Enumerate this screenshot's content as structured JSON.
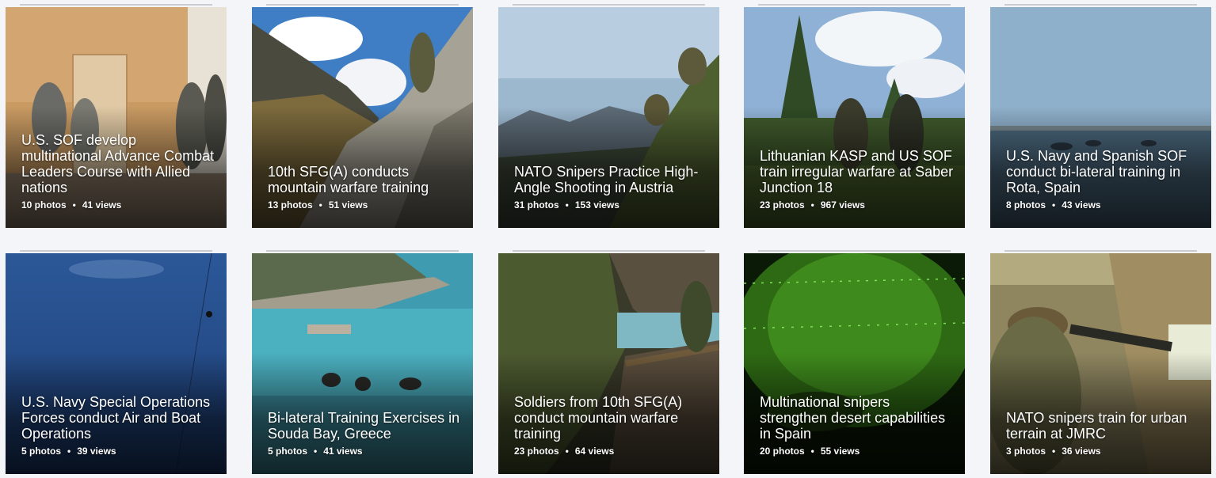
{
  "albums": [
    {
      "title": "U.S. SOF develop multinational Advance Combat Leaders Course with Allied nations",
      "photos": "10 photos",
      "views": "41 views"
    },
    {
      "title": "10th SFG(A) conducts mountain warfare training",
      "photos": "13 photos",
      "views": "51 views"
    },
    {
      "title": "NATO Snipers Practice High-Angle Shooting in Austria",
      "photos": "31 photos",
      "views": "153 views"
    },
    {
      "title": "Lithuanian KASP and US SOF train irregular warfare at Saber Junction 18",
      "photos": "23 photos",
      "views": "967 views"
    },
    {
      "title": "U.S. Navy and Spanish SOF conduct bi-lateral training in Rota, Spain",
      "photos": "8 photos",
      "views": "43 views"
    },
    {
      "title": "U.S. Navy Special Operations Forces conduct Air and Boat Operations",
      "photos": "5 photos",
      "views": "39 views"
    },
    {
      "title": "Bi-lateral Training Exercises in Souda Bay, Greece",
      "photos": "5 photos",
      "views": "41 views"
    },
    {
      "title": "Soldiers from 10th SFG(A) conduct mountain warfare training",
      "photos": "23 photos",
      "views": "64 views"
    },
    {
      "title": "Multinational snipers strengthen desert capabilities in Spain",
      "photos": "20 photos",
      "views": "55 views"
    },
    {
      "title": "NATO snipers train for urban terrain at JMRC",
      "photos": "3 photos",
      "views": "36 views"
    }
  ],
  "meta_separator": "•",
  "colors": {
    "background": "#f3f5f8",
    "caption_text": "#ffffff"
  }
}
